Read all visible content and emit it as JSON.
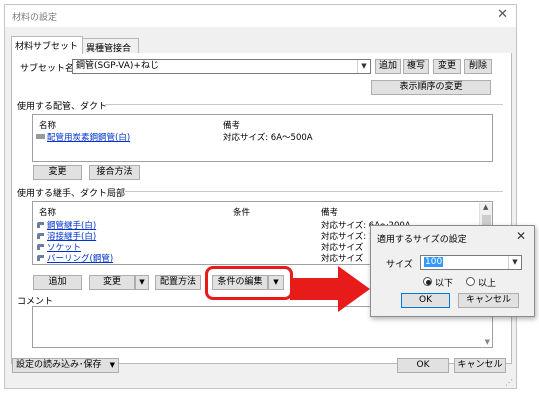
{
  "window": {
    "title": "材料の設定",
    "close_glyph": "✕"
  },
  "tabs": [
    {
      "label": "材料サブセット",
      "active": true
    },
    {
      "label": "異種管接合",
      "active": false
    }
  ],
  "subset": {
    "label": "サブセット名",
    "value": "鋼管(SGP-VA)+ねじ",
    "buttons": {
      "add": "追加",
      "copy": "複写",
      "change": "変更",
      "delete": "削除"
    },
    "order_button": "表示順序の変更"
  },
  "pipes_section": {
    "title": "使用する配管、ダクト",
    "headers": {
      "name": "名称",
      "note": "備考"
    },
    "rows": [
      {
        "name": "配管用炭素鋼鋼管(白)",
        "note": "対応サイズ: 6A～500A"
      }
    ],
    "buttons": {
      "change": "変更",
      "joint": "接合方法"
    }
  },
  "fittings_section": {
    "title": "使用する継手、ダクト局部",
    "headers": {
      "name": "名称",
      "condition": "条件",
      "note": "備考"
    },
    "rows": [
      {
        "name": "鋼管継手(白)",
        "condition": "",
        "note": "対応サイズ: 6A～200A"
      },
      {
        "name": "溶接継手(白)",
        "condition": "",
        "note": "対応サイズ: 15A"
      },
      {
        "name": "ソケット",
        "condition": "",
        "note": "対応サイズ"
      },
      {
        "name": "バーリング(鋼管)",
        "condition": "",
        "note": "対応サイズ"
      }
    ],
    "buttons": {
      "add": "追加",
      "change": "変更",
      "layout": "配置方法",
      "edit_condition": "条件の編集"
    }
  },
  "comment": {
    "label": "コメント",
    "value": ""
  },
  "footer": {
    "settings_menu": "設定の読み込み･保存",
    "ok": "OK",
    "cancel": "キャンセル"
  },
  "dialog": {
    "title": "適用するサイズの設定",
    "close_glyph": "✕",
    "size_label": "サイズ",
    "size_value": "100",
    "options": [
      {
        "label": "以下",
        "selected": true
      },
      {
        "label": "以上",
        "selected": false
      }
    ],
    "ok": "OK",
    "cancel": "キャンセル"
  },
  "colors": {
    "highlight": "#e81b1b",
    "link": "#0033cc",
    "selection": "#3399ff"
  }
}
